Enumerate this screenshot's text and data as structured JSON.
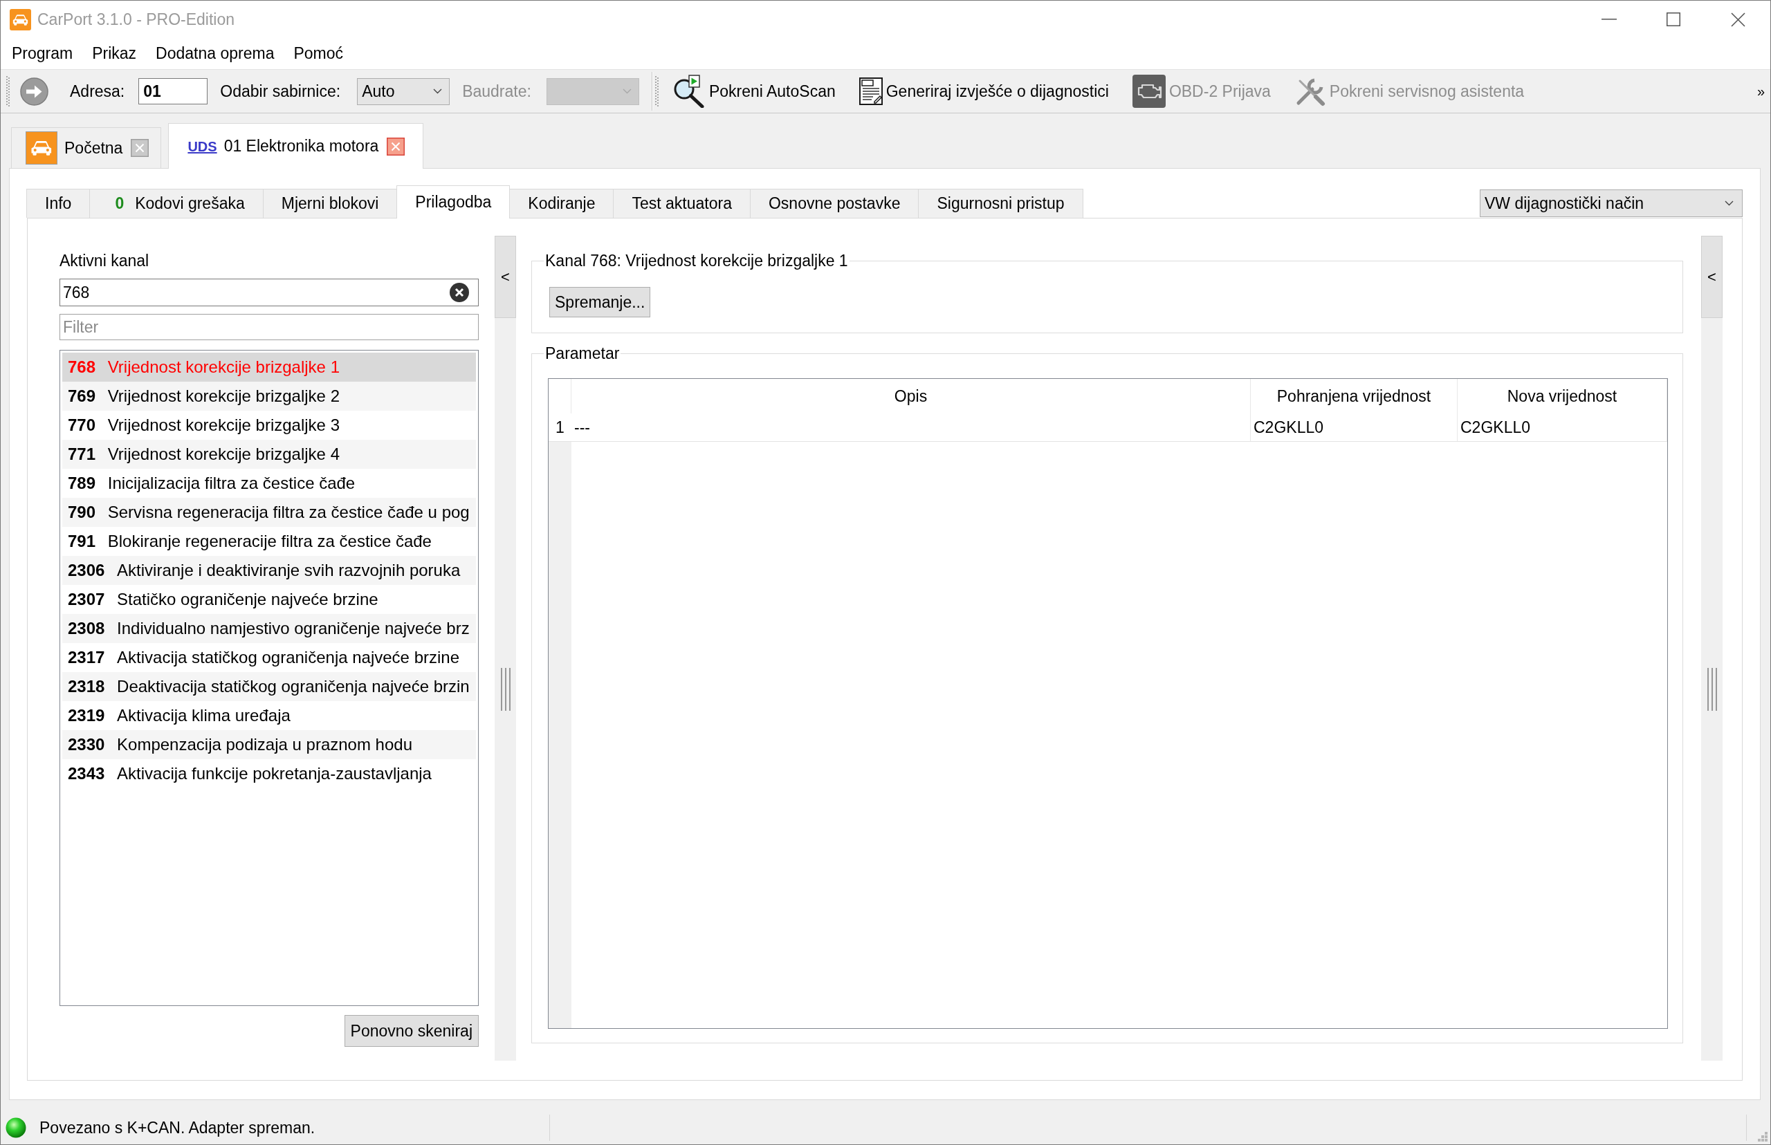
{
  "window": {
    "title": "CarPort 3.1.0 - PRO-Edition"
  },
  "menu": [
    {
      "label": "Program"
    },
    {
      "label": "Prikaz"
    },
    {
      "label": "Dodatna oprema"
    },
    {
      "label": "Pomoć"
    }
  ],
  "toolbar": {
    "address": {
      "label": "Adresa:",
      "value": "01"
    },
    "bus": {
      "label": "Odabir sabirnice:",
      "value": "Auto"
    },
    "baudrate": {
      "label": "Baudrate:",
      "disabled": true
    },
    "actions": [
      {
        "kind": "scan",
        "label": "Pokreni AutoScan",
        "disabled": false
      },
      {
        "kind": "report",
        "label": "Generiraj izvješće o dijagnostici",
        "disabled": false
      },
      {
        "kind": "engine",
        "label": "OBD-2 Prijava",
        "disabled": true
      },
      {
        "kind": "service",
        "label": "Pokreni servisnog asistenta",
        "disabled": true
      }
    ],
    "overflow": "»"
  },
  "document_tabs": [
    {
      "kind": "home",
      "label": "Početna",
      "selected": false
    },
    {
      "kind": "module",
      "badge": "UDS",
      "label": "01 Elektronika motora",
      "selected": true
    }
  ],
  "tabs": [
    {
      "label": "Info",
      "selected": false
    },
    {
      "count": "0",
      "label": "Kodovi grešaka",
      "selected": false
    },
    {
      "label": "Mjerni blokovi",
      "selected": false
    },
    {
      "label": "Prilagodba",
      "selected": true
    },
    {
      "label": "Kodiranje",
      "selected": false
    },
    {
      "label": "Test aktuatora",
      "selected": false
    },
    {
      "label": "Osnovne postavke",
      "selected": false
    },
    {
      "label": "Sigurnosni pristup",
      "selected": false
    }
  ],
  "mode_select": {
    "value": "VW dijagnostički način"
  },
  "channel_panel": {
    "label": "Aktivni kanal",
    "channel_field": {
      "value": "768"
    },
    "filter_field": {
      "placeholder": "Filter"
    },
    "channels": [
      {
        "number": "768",
        "name": "Vrijednost korekcije brizgaljke 1",
        "selected": true
      },
      {
        "number": "769",
        "name": "Vrijednost korekcije brizgaljke 2",
        "selected": false
      },
      {
        "number": "770",
        "name": "Vrijednost korekcije brizgaljke 3",
        "selected": false
      },
      {
        "number": "771",
        "name": "Vrijednost korekcije brizgaljke 4",
        "selected": false
      },
      {
        "number": "789",
        "name": "Inicijalizacija filtra za čestice čađe",
        "selected": false
      },
      {
        "number": "790",
        "name": "Servisna regeneracija filtra za čestice čađe u pog",
        "selected": false
      },
      {
        "number": "791",
        "name": "Blokiranje regeneracije filtra za čestice čađe",
        "selected": false
      },
      {
        "number": "2306",
        "name": "Aktiviranje i deaktiviranje svih razvojnih poruka",
        "selected": false
      },
      {
        "number": "2307",
        "name": "Statičko ograničenje najveće brzine",
        "selected": false
      },
      {
        "number": "2308",
        "name": "Individualno namjestivo ograničenje najveće brz",
        "selected": false
      },
      {
        "number": "2317",
        "name": "Aktivacija statičkog ograničenja najveće brzine",
        "selected": false
      },
      {
        "number": "2318",
        "name": "Deaktivacija statičkog ograničenja najveće brzin",
        "selected": false
      },
      {
        "number": "2319",
        "name": "Aktivacija klima uređaja",
        "selected": false
      },
      {
        "number": "2330",
        "name": "Kompenzacija podizaja u praznom hodu",
        "selected": false
      },
      {
        "number": "2343",
        "name": "Aktivacija funkcije pokretanja-zaustavljanja",
        "selected": false
      }
    ],
    "rescan_button": "Ponovno skeniraj"
  },
  "left_splitter": {
    "button": "<"
  },
  "channel_group": {
    "title": "Kanal 768: Vrijednost korekcije brizgaljke 1",
    "save_button": "Spremanje..."
  },
  "parameter_group": {
    "title": "Parametar",
    "table": {
      "columns": [
        "Opis",
        "Pohranjena vrijednost",
        "Nova vrijednost"
      ],
      "rows": [
        {
          "index": "1",
          "cells": [
            "---",
            "C2GKLL0",
            "C2GKLL0"
          ]
        }
      ]
    }
  },
  "right_splitter": {
    "button": "<"
  },
  "status_bar": {
    "connected": true,
    "text": "Povezano s K+CAN. Adapter spreman."
  }
}
